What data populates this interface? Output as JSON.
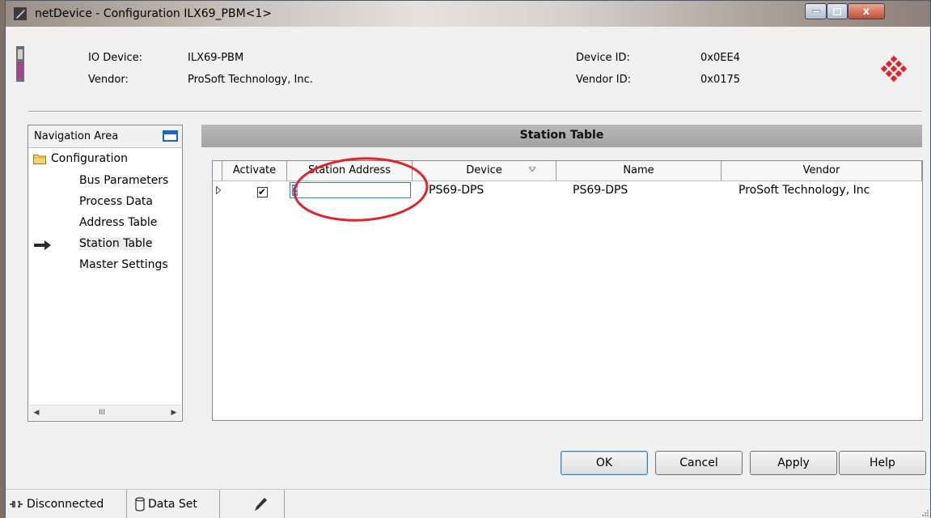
{
  "window": {
    "title": "netDevice - Configuration ILX69_PBM<1>",
    "close_glyph": "x"
  },
  "device_info": {
    "io_device_label": "IO Device:",
    "io_device_value": "ILX69-PBM",
    "vendor_label": "Vendor:",
    "vendor_value": "ProSoft Technology, Inc.",
    "device_id_label": "Device ID:",
    "device_id_value": "0x0EE4",
    "vendor_id_label": "Vendor ID:",
    "vendor_id_value": "0x0175"
  },
  "navigation": {
    "header": "Navigation Area",
    "root": "Configuration",
    "items": [
      {
        "label": "Bus Parameters",
        "selected": false
      },
      {
        "label": "Process Data",
        "selected": false
      },
      {
        "label": "Address Table",
        "selected": false
      },
      {
        "label": "Station Table",
        "selected": true
      },
      {
        "label": "Master Settings",
        "selected": false
      }
    ],
    "scroll_left": "◀",
    "scroll_thumb": "III",
    "scroll_right": "▶"
  },
  "station_table": {
    "title": "Station Table",
    "columns": [
      "Activate",
      "Station Address",
      "Device",
      "Name",
      "Vendor"
    ],
    "rows": [
      {
        "activate_glyph": "✔",
        "activate": true,
        "station_address": "2",
        "device": "PS69-DPS",
        "name": "PS69-DPS",
        "vendor": "ProSoft Technology, Inc"
      }
    ]
  },
  "buttons": {
    "ok": "OK",
    "cancel": "Cancel",
    "apply": "Apply",
    "help": "Help"
  },
  "status_bar": {
    "connection": "Disconnected",
    "data_set": "Data Set"
  },
  "colors": {
    "highlight_ellipse": "#e0242a",
    "selection": "#3399ff",
    "header_bar": "#a8a8a8"
  }
}
